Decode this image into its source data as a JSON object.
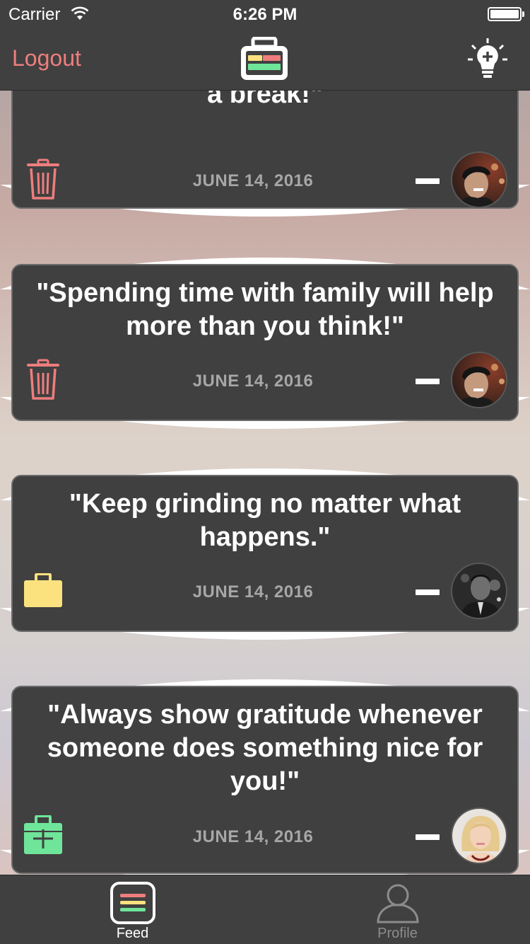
{
  "status_bar": {
    "carrier": "Carrier",
    "time": "6:26 PM"
  },
  "nav": {
    "logout_label": "Logout",
    "logo_icon": "lunchbox-logo-icon",
    "right_icon": "add-idea-lightbulb-icon"
  },
  "colors": {
    "accent_red": "#ef7d7d",
    "accent_yellow": "#fce27e",
    "accent_green": "#6fe59a",
    "panel": "#404040"
  },
  "cards": [
    {
      "quote": "\"Don't ever do it. Even the best need a break!\"",
      "date": "JUNE 14, 2016",
      "action_icon": "trash-icon",
      "avatar": "user-avatar-cap"
    },
    {
      "quote": "\"Spending time with family will help more than you think!\"",
      "date": "JUNE 14, 2016",
      "action_icon": "trash-icon",
      "avatar": "user-avatar-cap"
    },
    {
      "quote": "\"Keep grinding no matter what happens.\"",
      "date": "JUNE 14, 2016",
      "action_icon": "briefcase-icon",
      "avatar": "user-avatar-bw"
    },
    {
      "quote": "\"Always show gratitude whenever someone does something nice for you!\"",
      "date": "JUNE 14, 2016",
      "action_icon": "add-briefcase-icon",
      "avatar": "user-avatar-blonde"
    }
  ],
  "tabs": [
    {
      "label": "Feed",
      "icon": "feed-icon",
      "active": true
    },
    {
      "label": "Profile",
      "icon": "profile-icon",
      "active": false
    }
  ]
}
